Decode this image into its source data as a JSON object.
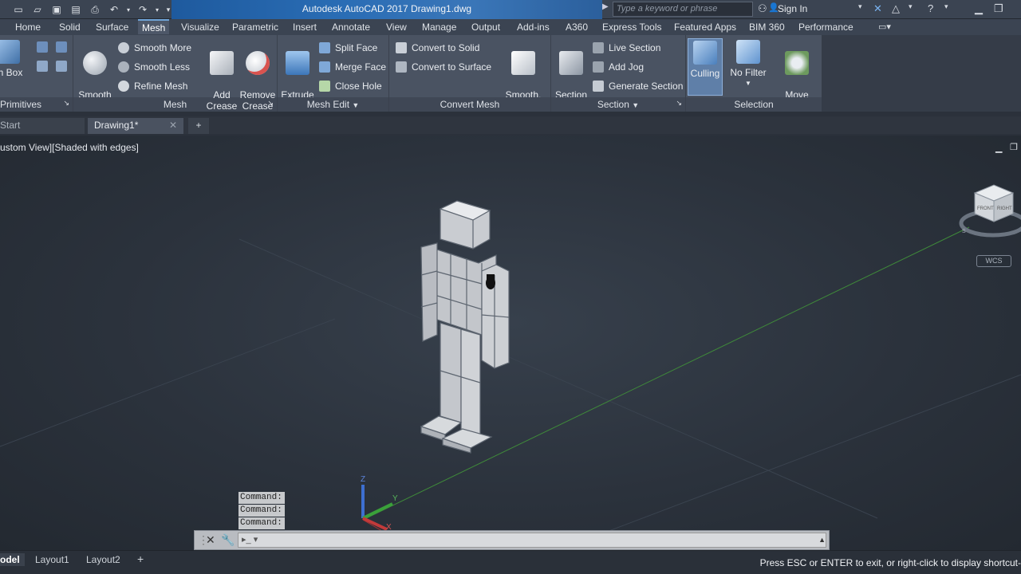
{
  "titlebar": {
    "app_title": "Autodesk AutoCAD 2017   Drawing1.dwg",
    "search_placeholder": "Type a keyword or phrase",
    "sign_in": "Sign In"
  },
  "tabs": [
    "Home",
    "Solid",
    "Surface",
    "Mesh",
    "Visualize",
    "Parametric",
    "Insert",
    "Annotate",
    "View",
    "Manage",
    "Output",
    "Add-ins",
    "A360",
    "Express Tools",
    "Featured Apps",
    "BIM 360",
    "Performance"
  ],
  "active_tab": "Mesh",
  "ribbon": {
    "primitives": {
      "mesh_box": "sh Box",
      "label": "Primitives"
    },
    "mesh": {
      "smooth_object": "Smooth\nObject",
      "smooth_more": "Smooth More",
      "smooth_less": "Smooth Less",
      "refine_mesh": "Refine Mesh",
      "label": "Mesh"
    },
    "mesh_edit": {
      "add_crease": "Add\nCrease",
      "remove_crease": "Remove\nCrease",
      "extrude_face": "Extrude\nFace",
      "split_face": "Split Face",
      "merge_face": "Merge Face",
      "close_hole": "Close Hole",
      "label": "Mesh Edit"
    },
    "convert_mesh": {
      "convert_to_solid": "Convert to Solid",
      "convert_to_surface": "Convert to Surface",
      "smooth_optimized": "Smooth,\noptimized",
      "label": "Convert Mesh"
    },
    "section": {
      "section_plane": "Section\nPlane",
      "live_section": "Live Section",
      "add_jog": "Add Jog",
      "generate_section": "Generate Section",
      "label": "Section"
    },
    "selection": {
      "culling": "Culling",
      "no_filter": "No Filter",
      "move_gizmo": "Move\nGizmo",
      "label": "Selection"
    }
  },
  "doc_tabs": {
    "start": "Start",
    "drawing": "Drawing1*"
  },
  "viewport": {
    "label": "ustom View][Shaded with edges]",
    "wcs": "WCS"
  },
  "command": {
    "history": [
      "Command:",
      "Command:",
      "Command:"
    ]
  },
  "status": {
    "layout_tabs": [
      "odel",
      "Layout1",
      "Layout2"
    ],
    "message": "Press ESC or ENTER to exit, or right-click to display shortcut-"
  },
  "colors": {
    "accent": "#2a6db5",
    "ribbon": "#4a5362",
    "viewport": "#2b323c"
  }
}
